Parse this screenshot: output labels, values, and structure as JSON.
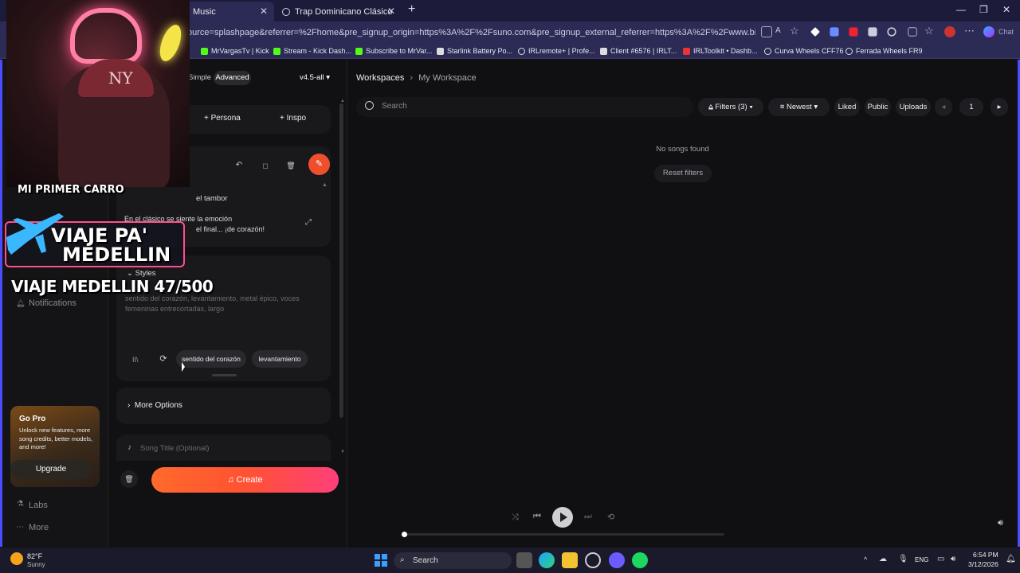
{
  "browser": {
    "tabs": [
      {
        "title": "Music",
        "active": true
      },
      {
        "title": "Trap Dominicano Clásico",
        "active": false
      }
    ],
    "new_tab": "+",
    "url": "ource=splashpage&referrer=%2Fhome&pre_signup_origin=https%3A%2F%2Fsuno.com&pre_signup_external_referrer=https%3A%2F%2Fwww.bing.com%2F&redirected_fr...",
    "chat_label": "Chat",
    "bookmarks": [
      "MrVargasTv | Kick",
      "Stream - Kick Dash...",
      "Subscribe to MrVar...",
      "Starlink Battery Po...",
      "IRLremote+ | Profe...",
      "Client #6576 | IRLT...",
      "IRLToolkit • Dashb...",
      "Curva Wheels CFF76",
      "Ferrada Wheels FR9"
    ]
  },
  "stream_overlay": {
    "badge_text": "MI PRIMER CARRO",
    "banner_line1": "VIAJE PA'",
    "banner_line2": "MEDELLIN",
    "counter_text": "VIAJE MEDELLIN 47/500"
  },
  "left_nav": {
    "notifications": "Notifications",
    "go_pro": {
      "title": "Go Pro",
      "text": "Unlock new features, more song credits, better models, and more!",
      "button": "Upgrade"
    },
    "labs": "Labs",
    "more": "More"
  },
  "create_panel": {
    "modes": [
      "Simple",
      "Advanced"
    ],
    "model": "v4.5-all",
    "persona": "Persona",
    "inspo": "Inspo",
    "lyrics_line1": "el tambor",
    "lyrics_line2": "En el clásico se siente la emoción",
    "lyrics_line3": "el final... ¡de corazón!",
    "styles_label": "Styles",
    "styles_text": "sentido del corazón, levantamiento, metal épico, voces femeninas entrecortadas, largo",
    "style_tags": [
      "sentido del corazón",
      "levantamiento"
    ],
    "more_options": "More Options",
    "song_title_placeholder": "Song Title (Optional)",
    "create_button": "Create"
  },
  "workspace": {
    "breadcrumb_root": "Workspaces",
    "breadcrumb_sep": "›",
    "breadcrumb_current": "My Workspace",
    "search_placeholder": "Search",
    "filters": "Filters (3)",
    "sort": "Newest",
    "liked": "Liked",
    "public": "Public",
    "uploads": "Uploads",
    "page": "1",
    "empty_text": "No songs found",
    "reset_filters": "Reset filters"
  },
  "player": {
    "progress": 0.0
  },
  "taskbar": {
    "weather_temp": "82°F",
    "weather_cond": "Sunny",
    "search": "Search",
    "lang": "ENG",
    "time": "6:54 PM",
    "date": "3/12/2026"
  },
  "colors": {
    "accent": "#ef4f2c",
    "create_gradient_start": "#ff6a2b",
    "create_gradient_end": "#ff3f7a",
    "window_border": "#4b4bff"
  }
}
